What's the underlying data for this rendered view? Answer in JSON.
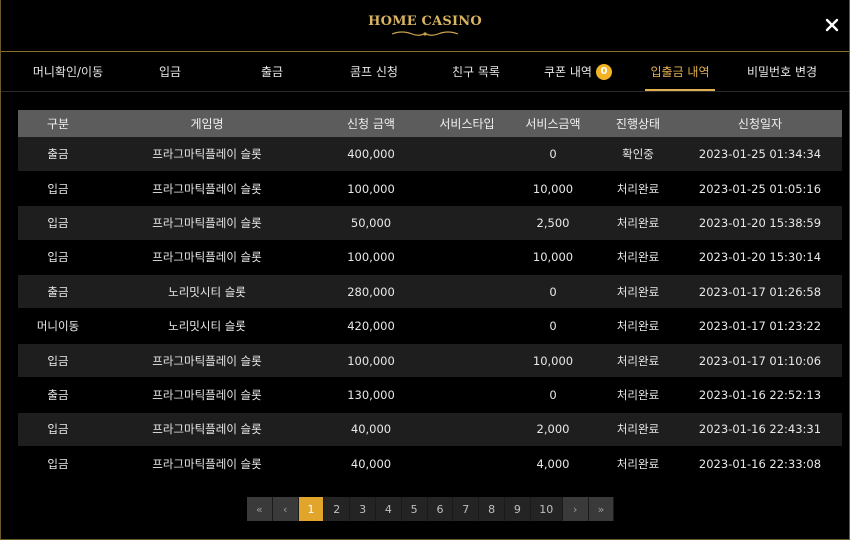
{
  "header": {
    "logo_text": "HOME CASINO",
    "close_icon": "close-icon",
    "accent_color": "#e0b050"
  },
  "tabs": [
    {
      "label": "머니확인/이동"
    },
    {
      "label": "입금"
    },
    {
      "label": "출금"
    },
    {
      "label": "콤프 신청"
    },
    {
      "label": "친구 목록"
    },
    {
      "label": "쿠폰 내역",
      "badge": "0"
    },
    {
      "label": "입출금 내역",
      "active": true
    },
    {
      "label": "비밀번호 변경"
    }
  ],
  "table": {
    "columns": [
      "구분",
      "게임명",
      "신청 금액",
      "서비스타입",
      "서비스금액",
      "진행상태",
      "신청일자"
    ],
    "rows": [
      [
        "출금",
        "프라그마틱플레이 슬롯",
        "400,000",
        "",
        "0",
        "확인중",
        "2023-01-25 01:34:34"
      ],
      [
        "입금",
        "프라그마틱플레이 슬롯",
        "100,000",
        "",
        "10,000",
        "처리완료",
        "2023-01-25 01:05:16"
      ],
      [
        "입금",
        "프라그마틱플레이 슬롯",
        "50,000",
        "",
        "2,500",
        "처리완료",
        "2023-01-20 15:38:59"
      ],
      [
        "입금",
        "프라그마틱플레이 슬롯",
        "100,000",
        "",
        "10,000",
        "처리완료",
        "2023-01-20 15:30:14"
      ],
      [
        "출금",
        "노리밋시티 슬롯",
        "280,000",
        "",
        "0",
        "처리완료",
        "2023-01-17 01:26:58"
      ],
      [
        "머니이동",
        "노리밋시티 슬롯",
        "420,000",
        "",
        "0",
        "처리완료",
        "2023-01-17 01:23:22"
      ],
      [
        "입금",
        "프라그마틱플레이 슬롯",
        "100,000",
        "",
        "10,000",
        "처리완료",
        "2023-01-17 01:10:06"
      ],
      [
        "출금",
        "프라그마틱플레이 슬롯",
        "130,000",
        "",
        "0",
        "처리완료",
        "2023-01-16 22:52:13"
      ],
      [
        "입금",
        "프라그마틱플레이 슬롯",
        "40,000",
        "",
        "2,000",
        "처리완료",
        "2023-01-16 22:43:31"
      ],
      [
        "입금",
        "프라그마틱플레이 슬롯",
        "40,000",
        "",
        "4,000",
        "처리완료",
        "2023-01-16 22:33:08"
      ]
    ]
  },
  "pagination": {
    "first": "«",
    "prev": "‹",
    "pages": [
      "1",
      "2",
      "3",
      "4",
      "5",
      "6",
      "7",
      "8",
      "9",
      "10"
    ],
    "current": "1",
    "next": "›",
    "last": "»"
  }
}
